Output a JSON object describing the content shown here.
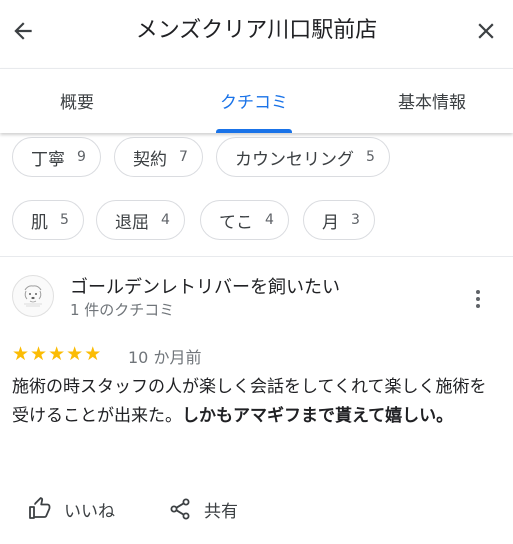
{
  "header": {
    "title": "メンズクリア川口駅前店",
    "back_icon": "arrow-left-icon",
    "close_icon": "close-icon"
  },
  "tabs": [
    {
      "label": "概要",
      "selected": false
    },
    {
      "label": "クチコミ",
      "selected": true
    },
    {
      "label": "基本情報",
      "selected": false
    }
  ],
  "colors": {
    "accent": "#1a73e8",
    "star": "#fbbc04",
    "text": "#202124",
    "muted": "#70757a"
  },
  "topic_chips": [
    {
      "label": "丁寧",
      "count": "9"
    },
    {
      "label": "契約",
      "count": "7"
    },
    {
      "label": "カウンセリング",
      "count": "5"
    },
    {
      "label": "肌",
      "count": "5"
    },
    {
      "label": "退屈",
      "count": "4"
    },
    {
      "label": "てこ",
      "count": "4"
    },
    {
      "label": "月",
      "count": "3"
    }
  ],
  "review": {
    "author": "ゴールデンレトリバーを飼いたい",
    "author_meta": "1 件のクチコミ",
    "rating": 5,
    "date": "10 か月前",
    "text_plain": "施術の時スタッフの人が楽しく会話をしてくれて楽しく施術を受けることが出来た。",
    "text_bold": "しかもアマギフまで貰えて嬉しい。",
    "more_icon": "more-vert-icon"
  },
  "actions": {
    "like_label": "いいね",
    "like_icon": "thumb-up-icon",
    "share_label": "共有",
    "share_icon": "share-icon"
  }
}
